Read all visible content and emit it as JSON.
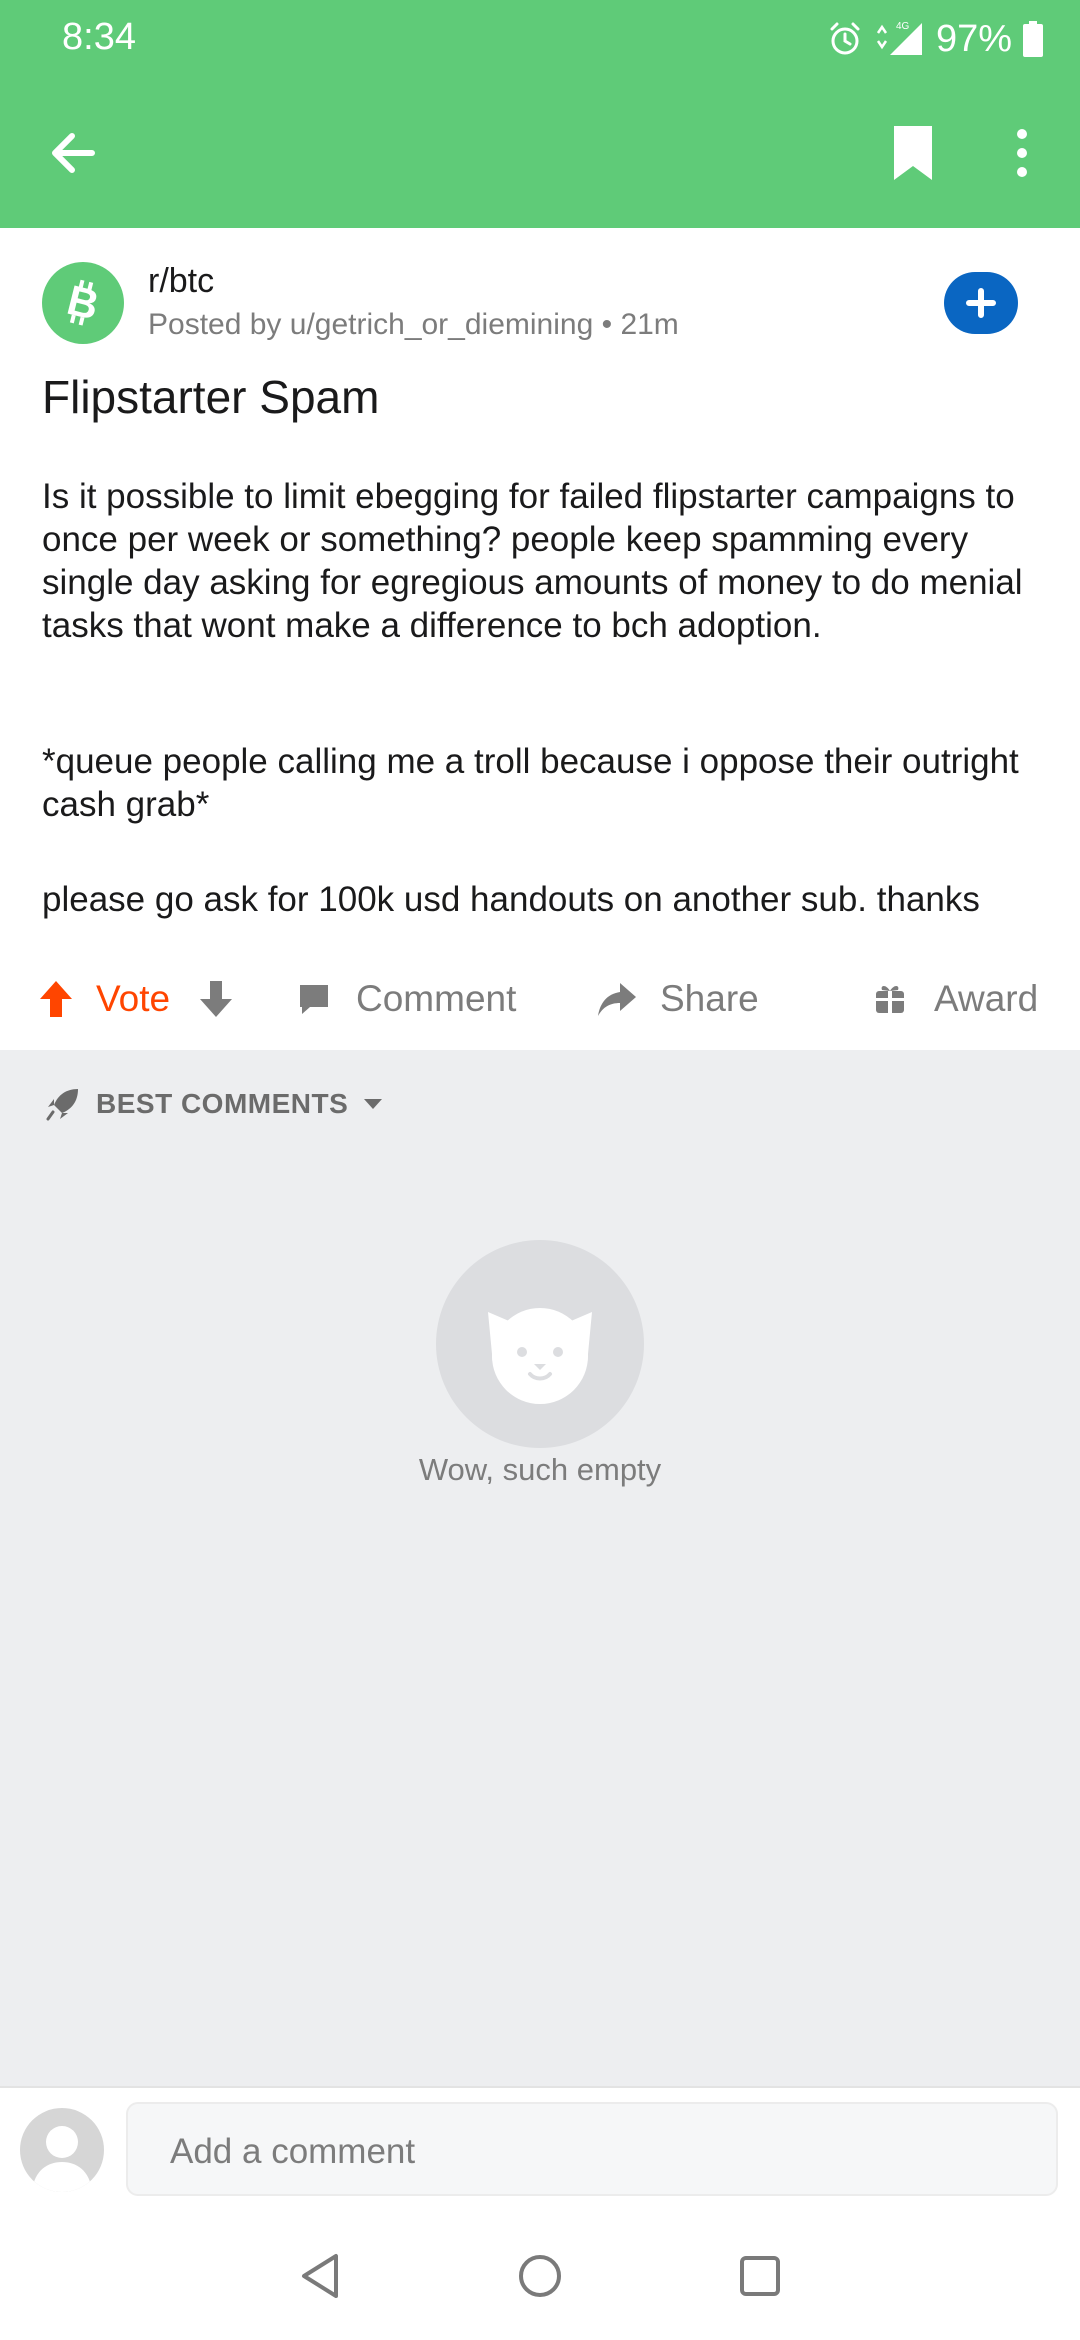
{
  "status_bar": {
    "time": "8:34",
    "network": "4G",
    "battery": "97%"
  },
  "header": {
    "background_color": "#5fcb78",
    "icons": [
      "back-arrow-icon",
      "bookmark-icon",
      "more-vertical-icon"
    ]
  },
  "post": {
    "subreddit": "r/btc",
    "meta": "Posted by u/getrich_or_diemining • 21m",
    "title": "Flipstarter Spam",
    "body": [
      "Is it possible to limit ebegging for failed flipstarter campaigns to once per week or something? people keep spamming every single day asking for egregious amounts of money to do menial tasks that wont make a difference to bch adoption.",
      "*queue people calling me a troll because i oppose their outright cash grab*",
      "please go ask for 100k usd handouts on another sub. thanks"
    ]
  },
  "actions": {
    "vote": "Vote",
    "comment": "Comment",
    "share": "Share",
    "award": "Award",
    "vote_color": "#ff4500"
  },
  "comments": {
    "sort_label": "BEST COMMENTS",
    "empty_text": "Wow, such empty"
  },
  "comment_bar": {
    "placeholder": "Add a comment"
  }
}
